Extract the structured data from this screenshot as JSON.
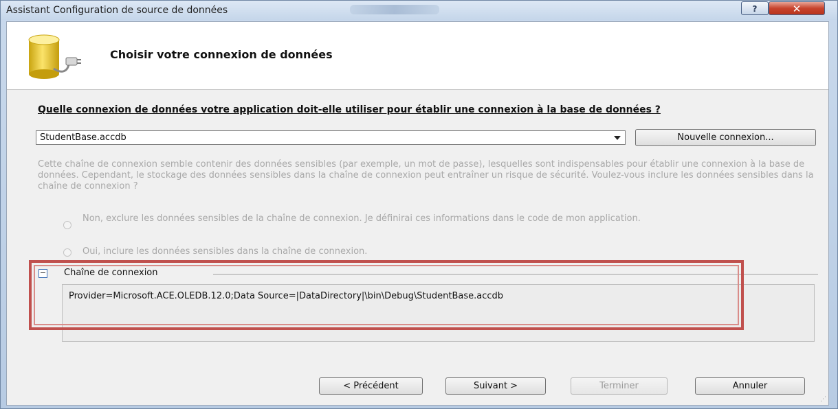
{
  "window": {
    "title": "Assistant Configuration de source de données",
    "help_label": "?",
    "close_label": "✕"
  },
  "header": {
    "title": "Choisir votre connexion de données",
    "icon": "database-plug-icon"
  },
  "question": "Quelle connexion de données votre application doit-elle utiliser pour établir une connexion à la base de données ?",
  "connection_select": {
    "value": "StudentBase.accdb"
  },
  "new_connection_button": "Nouvelle connexion...",
  "sensitive_notice": "Cette chaîne de connexion semble contenir des données sensibles (par exemple, un mot de passe), lesquelles sont indispensables pour établir une connexion à la base de données. Cependant, le stockage des données sensibles dans la chaîne de connexion peut entraîner un risque de sécurité. Voulez-vous inclure les données sensibles dans la chaîne de connexion ?",
  "options": [
    {
      "label": "Non, exclure les données sensibles de la chaîne de connexion. Je définirai ces informations dans le code de mon application.",
      "selected": false
    },
    {
      "label": "Oui, inclure les données sensibles dans la chaîne de connexion.",
      "selected": false
    }
  ],
  "connection_string": {
    "label": "Chaîne de connexion",
    "expander_symbol": "−",
    "value": "Provider=Microsoft.ACE.OLEDB.12.0;Data Source=|DataDirectory|\\bin\\Debug\\StudentBase.accdb"
  },
  "highlight_color": "#c0504d",
  "buttons": {
    "previous": "< Précédent",
    "next": "Suivant >",
    "finish": "Terminer",
    "cancel": "Annuler"
  }
}
